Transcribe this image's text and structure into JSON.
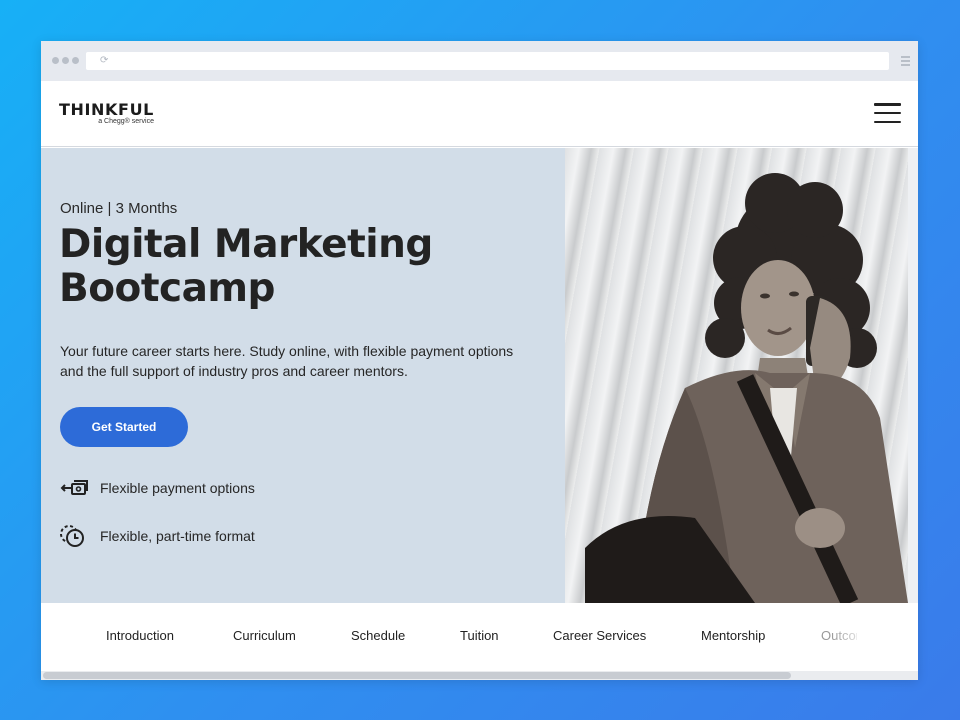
{
  "browser": {
    "reload_glyph": "⟳"
  },
  "header": {
    "logo_text": "THINKFUL",
    "logo_sub": "a Chegg® service"
  },
  "hero": {
    "format_line": "Online | 3 Months",
    "title": "Digital Marketing Bootcamp",
    "description": "Your future career starts here. Study online, with flexible payment options and the full support of industry pros and career mentors.",
    "cta_label": "Get Started",
    "cta_color": "#2d6bd8",
    "background_color": "#d2dde8",
    "features": [
      {
        "icon": "payment-transfer-icon",
        "label": "Flexible payment options"
      },
      {
        "icon": "clock-dashed-icon",
        "label": "Flexible, part-time format"
      }
    ]
  },
  "subnav": {
    "items": [
      "Introduction",
      "Curriculum",
      "Schedule",
      "Tuition",
      "Career Services",
      "Mentorship",
      "Outcomes"
    ]
  }
}
